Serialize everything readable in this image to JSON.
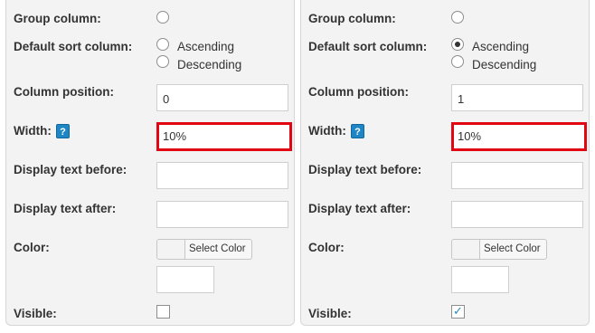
{
  "left": {
    "group_column_label": "Group column:",
    "default_sort_label": "Default sort column:",
    "ascending_label": "Ascending",
    "descending_label": "Descending",
    "sort_selected": "none",
    "column_position_label": "Column position:",
    "column_position_value": "0",
    "width_label": "Width:",
    "width_value": "10%",
    "help_icon": "?",
    "display_before_label": "Display text before:",
    "display_before_value": "",
    "display_after_label": "Display text after:",
    "display_after_value": "",
    "color_label": "Color:",
    "select_color_label": "Select Color",
    "color_value": "",
    "visible_label": "Visible:",
    "visible_checked": false
  },
  "right": {
    "group_column_label": "Group column:",
    "default_sort_label": "Default sort column:",
    "ascending_label": "Ascending",
    "descending_label": "Descending",
    "sort_selected": "ascending",
    "column_position_label": "Column position:",
    "column_position_value": "1",
    "width_label": "Width:",
    "width_value": "10%",
    "help_icon": "?",
    "display_before_label": "Display text before:",
    "display_before_value": "",
    "display_after_label": "Display text after:",
    "display_after_value": "",
    "color_label": "Color:",
    "select_color_label": "Select Color",
    "color_value": "",
    "visible_label": "Visible:",
    "visible_checked": true,
    "checkmark": "✓"
  },
  "colors": {
    "highlight": "#e20613",
    "help_icon_bg": "#1f86c6",
    "panel_bg": "#f3f3f3"
  }
}
